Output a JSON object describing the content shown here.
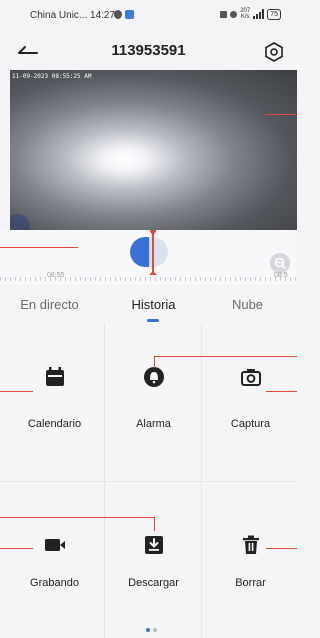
{
  "status_bar": {
    "carrier": "China Unic...",
    "time": "14:27",
    "speed_value": "207",
    "speed_unit": "K/s",
    "battery": "75"
  },
  "header": {
    "title": "113953591",
    "back_icon": "back-arrow-icon",
    "settings_icon": "settings-hexagon-icon"
  },
  "video": {
    "timestamp": "11-09-2023 08:55:25 AM"
  },
  "timeline": {
    "start_label": "08:55",
    "end_label": "08:5"
  },
  "tabs": [
    {
      "label": "En directo",
      "active": false
    },
    {
      "label": "Historia",
      "active": true
    },
    {
      "label": "Nube",
      "active": false
    }
  ],
  "actions": [
    {
      "label": "Calendario",
      "icon": "calendar-icon"
    },
    {
      "label": "Alarma",
      "icon": "bell-icon"
    },
    {
      "label": "Captura",
      "icon": "camera-icon"
    },
    {
      "label": "Grabando",
      "icon": "video-camera-icon"
    },
    {
      "label": "Descargar",
      "icon": "download-icon"
    },
    {
      "label": "Borrar",
      "icon": "trash-icon"
    }
  ],
  "colors": {
    "accent": "#3a6fd8",
    "annotation": "#e04a3c"
  },
  "pager": {
    "pages": 2,
    "active": 1
  }
}
